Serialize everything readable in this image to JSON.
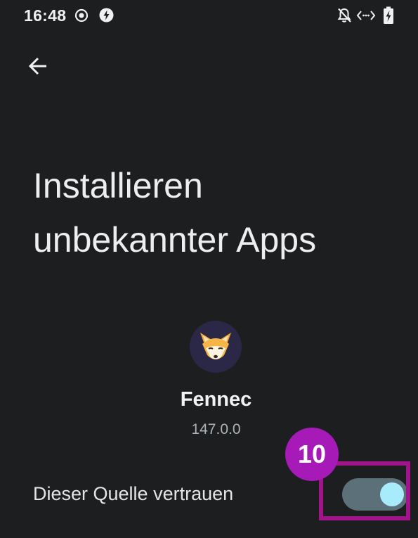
{
  "status_bar": {
    "time": "16:48",
    "icons": [
      "record-icon",
      "charging-bolt-icon",
      "notifications-off-icon",
      "data-saver-icon",
      "battery-charging-icon"
    ]
  },
  "nav": {
    "back_icon": "arrow-back-icon"
  },
  "page": {
    "title": "Installieren unbekannter Apps"
  },
  "app": {
    "name": "Fennec",
    "version": "147.0.0",
    "icon": "fennec-fox-icon"
  },
  "trust": {
    "label": "Dieser Quelle vertrauen",
    "enabled": true
  },
  "annotation": {
    "step_number": "10",
    "color": "#a61ab8",
    "box_color": "#a1148a"
  },
  "colors": {
    "background": "#1c1e1f",
    "toggle_track": "#5b7078",
    "toggle_thumb": "#a8ecfb"
  }
}
